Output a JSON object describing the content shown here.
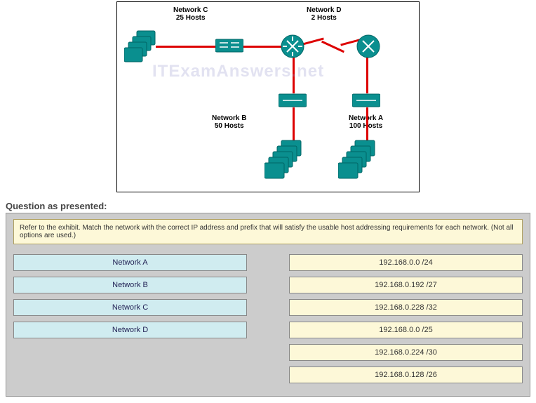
{
  "exhibit": {
    "networkC": {
      "title": "Network C",
      "hosts": "25 Hosts"
    },
    "networkD": {
      "title": "Network D",
      "hosts": "2 Hosts"
    },
    "networkB": {
      "title": "Network B",
      "hosts": "50 Hosts"
    },
    "networkA": {
      "title": "Network A",
      "hosts": "100 Hosts"
    },
    "watermark": "ITExamAnswers.net"
  },
  "heading": "Question as presented:",
  "prompt": "Refer to the exhibit. Match the network with the correct IP address and prefix that will satisfy the usable host addressing requirements for each network. (Not all options are used.)",
  "leftItems": [
    "Network A",
    "Network B",
    "Network C",
    "Network D"
  ],
  "rightItems": [
    "192.168.0.0 /24",
    "192.168.0.192 /27",
    "192.168.0.228 /32",
    "192.168.0.0 /25",
    "192.168.0.224 /30",
    "192.168.0.128 /26"
  ]
}
